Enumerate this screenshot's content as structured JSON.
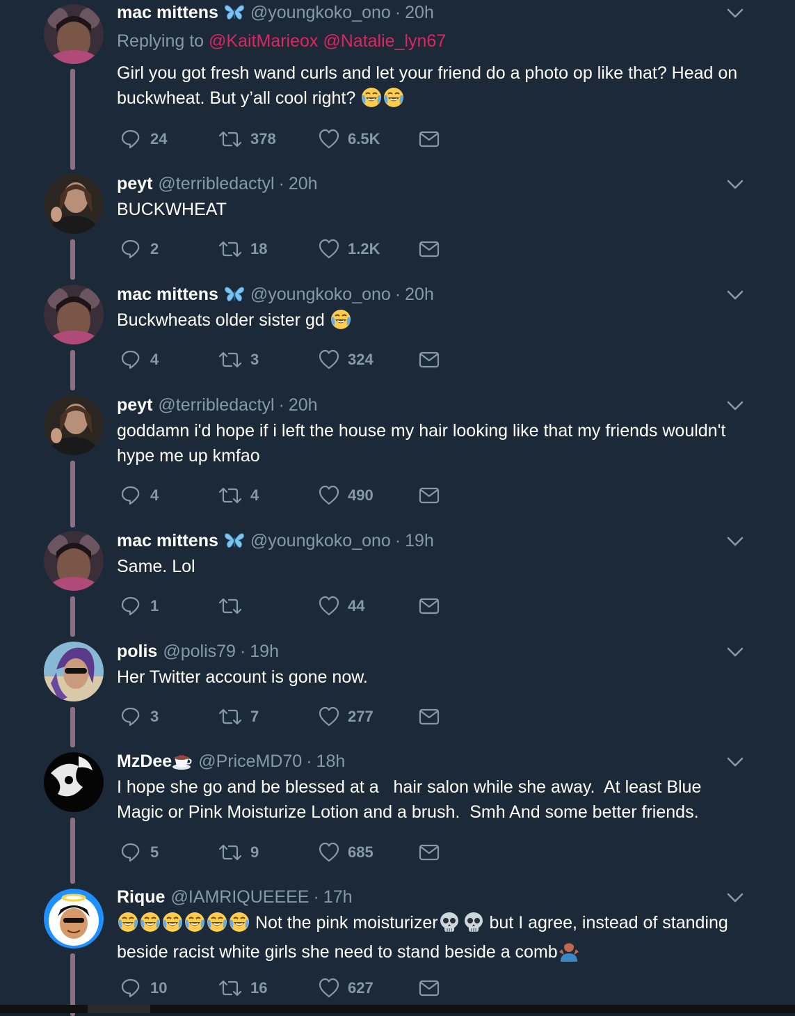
{
  "tweets": [
    {
      "name": "mac mittens",
      "badge": "butterfly",
      "handle": "@youngkoko_ono",
      "sep": "·",
      "time": "20h",
      "replying_prefix": "Replying to",
      "replying_to": [
        "@KaitMarieox",
        "@Natalie_lyn67"
      ],
      "text": "Girl you got fresh wand curls and let your friend do a photo op like that? Head on buckwheat. But y’all cool right?",
      "trailing_emoji": [
        "joy",
        "joy"
      ],
      "replies": "24",
      "retweets": "378",
      "likes": "6.5K"
    },
    {
      "name": "peyt",
      "handle": "@terribledactyl",
      "sep": "·",
      "time": "20h",
      "text": "BUCKWHEAT",
      "replies": "2",
      "retweets": "18",
      "likes": "1.2K"
    },
    {
      "name": "mac mittens",
      "badge": "butterfly",
      "handle": "@youngkoko_ono",
      "sep": "·",
      "time": "20h",
      "text": "Buckwheats older sister gd",
      "trailing_emoji": [
        "joy"
      ],
      "replies": "4",
      "retweets": "3",
      "likes": "324"
    },
    {
      "name": "peyt",
      "handle": "@terribledactyl",
      "sep": "·",
      "time": "20h",
      "text": "goddamn i'd hope if i left the house my hair looking like that my friends wouldn't hype me up kmfao",
      "replies": "4",
      "retweets": "4",
      "likes": "490"
    },
    {
      "name": "mac mittens",
      "badge": "butterfly",
      "handle": "@youngkoko_ono",
      "sep": "·",
      "time": "19h",
      "text": "Same. Lol",
      "replies": "1",
      "retweets": "",
      "likes": "44"
    },
    {
      "name": "polis",
      "handle": "@polis79",
      "sep": "·",
      "time": "19h",
      "text": "Her Twitter account is gone now.",
      "replies": "3",
      "retweets": "7",
      "likes": "277"
    },
    {
      "name": "MzDee",
      "badge": "cup",
      "handle": "@PriceMD70",
      "sep": "·",
      "time": "18h",
      "text": "I hope she go and be blessed at a   hair salon while she away.  At least Blue Magic or Pink Moisturize Lotion and a brush.  Smh And some better friends.",
      "replies": "5",
      "retweets": "9",
      "likes": "685"
    },
    {
      "name": "Rique",
      "handle": "@IAMRIQUEEEE",
      "sep": "·",
      "time": "17h",
      "lead_emoji": [
        "joy",
        "joy",
        "joy",
        "joy",
        "joy",
        "joy"
      ],
      "text_a": " Not the pink moisturizer",
      "mid_emoji": [
        "skull",
        "skull"
      ],
      "text_b": " but I agree, instead of standing beside racist white girls she need to stand beside a comb",
      "end_emoji": [
        "person-shrugging"
      ],
      "replies": "10",
      "retweets": "16",
      "likes": "627"
    }
  ],
  "colors": {
    "background": "#1c2938",
    "secondary_text": "#8899a6",
    "mention": "#e0245e",
    "thread_line": "#8e6f7f",
    "butterfly": "#7cc4f2"
  },
  "icons": [
    "reply-icon",
    "retweet-icon",
    "like-icon",
    "direct-message-icon",
    "chevron-down-icon"
  ]
}
